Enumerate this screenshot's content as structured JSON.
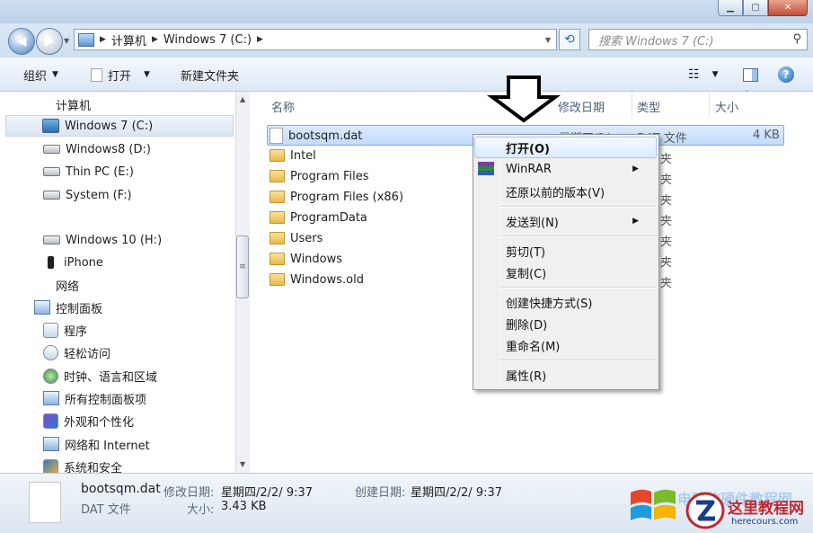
{
  "address": {
    "crumbs": [
      "计算机",
      "Windows 7  (C:)"
    ]
  },
  "search": {
    "placeholder": "搜索 Windows 7  (C:)"
  },
  "toolbar": {
    "organize": "组织",
    "open": "打开",
    "new_folder": "新建文件夹"
  },
  "sidebar": {
    "items": [
      {
        "label": "计算机",
        "icon": "computer-icon"
      },
      {
        "label": "Windows 7  (C:)",
        "icon": "system-drive-icon",
        "selected": true
      },
      {
        "label": "Windows8 (D:)",
        "icon": "drive-icon"
      },
      {
        "label": "Thin PC (E:)",
        "icon": "drive-icon"
      },
      {
        "label": "System (F:)",
        "icon": "drive-icon"
      },
      {
        "label": "Windows 10 (H:)",
        "icon": "drive-icon"
      },
      {
        "label": "iPhone",
        "icon": "phone-icon"
      },
      {
        "label": "网络",
        "icon": "network-icon"
      },
      {
        "label": "控制面板",
        "icon": "control-panel-icon"
      },
      {
        "label": "程序",
        "icon": "programs-icon"
      },
      {
        "label": "轻松访问",
        "icon": "ease-of-access-icon"
      },
      {
        "label": "时钟、语言和区域",
        "icon": "clock-language-icon"
      },
      {
        "label": "所有控制面板项",
        "icon": "control-panel-items-icon"
      },
      {
        "label": "外观和个性化",
        "icon": "appearance-icon"
      },
      {
        "label": "网络和 Internet",
        "icon": "network-internet-icon"
      },
      {
        "label": "系统和安全",
        "icon": "system-security-icon"
      }
    ]
  },
  "columns": {
    "name": "名称",
    "modified": "修改日期",
    "type": "类型",
    "size": "大小"
  },
  "files": [
    {
      "name": "bootsqm.dat",
      "kind": "file",
      "modified": "星期四/2/",
      "type": "DAT 文件",
      "size": "4 KB",
      "selected": true
    },
    {
      "name": "Intel",
      "kind": "folder",
      "type_tail": "夹"
    },
    {
      "name": "Program Files",
      "kind": "folder",
      "type_tail": "夹"
    },
    {
      "name": "Program Files (x86)",
      "kind": "folder",
      "type_tail": "夹"
    },
    {
      "name": "ProgramData",
      "kind": "folder",
      "type_tail": "夹"
    },
    {
      "name": "Users",
      "kind": "folder",
      "type_tail": "夹"
    },
    {
      "name": "Windows",
      "kind": "folder",
      "type_tail": "夹"
    },
    {
      "name": "Windows.old",
      "kind": "folder",
      "type_tail": "夹"
    }
  ],
  "context_menu": {
    "open": "打开(O)",
    "winrar": "WinRAR",
    "restore": "还原以前的版本(V)",
    "send_to": "发送到(N)",
    "cut": "剪切(T)",
    "copy": "复制(C)",
    "create_shortcut": "创建快捷方式(S)",
    "delete": "删除(D)",
    "rename": "重命名(M)",
    "properties": "属性(R)"
  },
  "details": {
    "filename": "bootsqm.dat",
    "modified_label": "修改日期:",
    "modified_value": "星期四/2/2/ 9:37",
    "created_label": "创建日期:",
    "created_value": "星期四/2/2/ 9:37",
    "type": "DAT 文件",
    "size_label": "大小:",
    "size_value": "3.43 KB"
  },
  "watermark": {
    "title": "这里教程网",
    "url": "herecours.com",
    "faded": "电脑软硬件教程网"
  },
  "colors": {
    "selection": "#c1dcfc",
    "accent": "#2a6ab5",
    "watermark_red": "#c0282d"
  }
}
